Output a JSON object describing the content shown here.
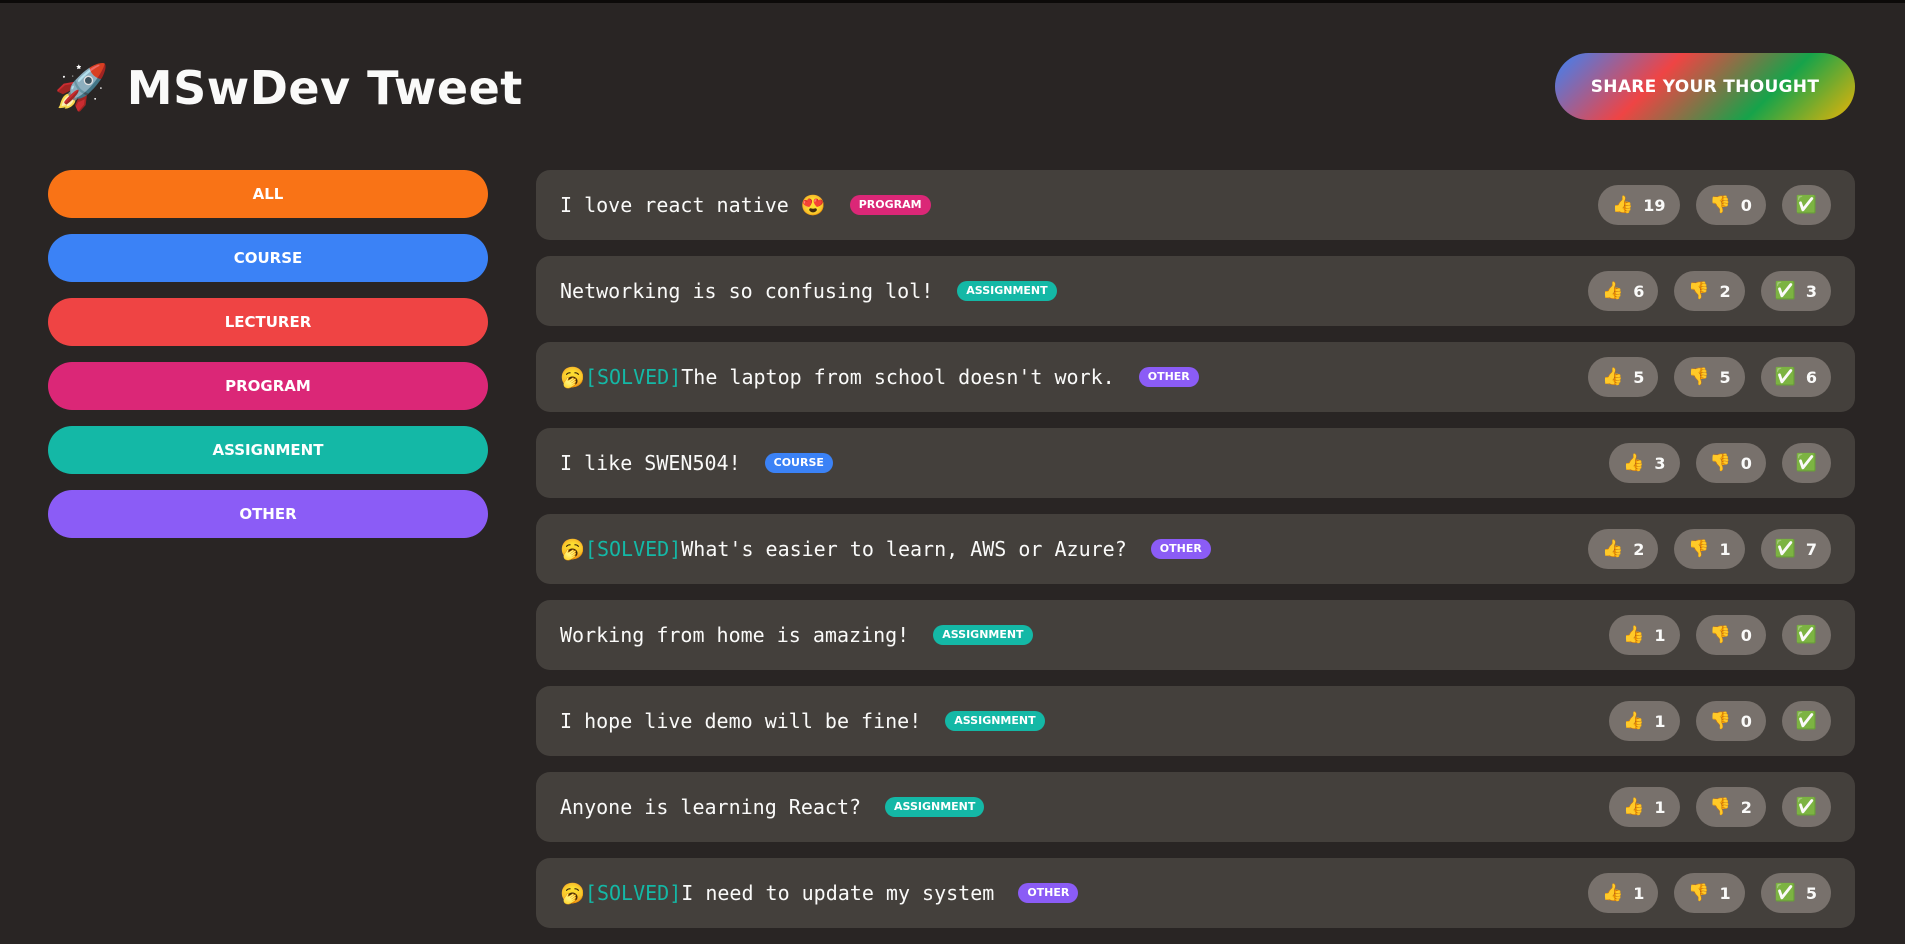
{
  "header": {
    "logo_icon": "🚀",
    "title": "MSwDev Tweet",
    "share_label": "Share your thought"
  },
  "categories": [
    {
      "label": "all",
      "color": "#f97316"
    },
    {
      "label": "course",
      "color": "#3b82f6"
    },
    {
      "label": "lecturer",
      "color": "#ef4444"
    },
    {
      "label": "program",
      "color": "#db2777"
    },
    {
      "label": "assignment",
      "color": "#14b8a6"
    },
    {
      "label": "other",
      "color": "#8b5cf6"
    }
  ],
  "vote_icons": {
    "interesting": "👍",
    "mindblowing": "👎",
    "solved": "✅"
  },
  "tweets": [
    {
      "solved": false,
      "text": "I love react native 😍",
      "tag": "program",
      "tag_color": "#db2777",
      "likes": "19",
      "dislikes": "0",
      "solved_count": ""
    },
    {
      "solved": false,
      "text": "Networking is so confusing lol!",
      "tag": "assignment",
      "tag_color": "#14b8a6",
      "likes": "6",
      "dislikes": "2",
      "solved_count": "3"
    },
    {
      "solved": true,
      "solved_icon": "🥱",
      "solved_label": "[SOLVED]",
      "text": "The laptop from school doesn't work.",
      "tag": "other",
      "tag_color": "#8b5cf6",
      "likes": "5",
      "dislikes": "5",
      "solved_count": "6"
    },
    {
      "solved": false,
      "text": "I like SWEN504!",
      "tag": "course",
      "tag_color": "#3b82f6",
      "likes": "3",
      "dislikes": "0",
      "solved_count": ""
    },
    {
      "solved": true,
      "solved_icon": "🥱",
      "solved_label": "[SOLVED]",
      "text": "What's easier to learn, AWS or Azure?",
      "tag": "other",
      "tag_color": "#8b5cf6",
      "likes": "2",
      "dislikes": "1",
      "solved_count": "7"
    },
    {
      "solved": false,
      "text": "Working from home is amazing!",
      "tag": "assignment",
      "tag_color": "#14b8a6",
      "likes": "1",
      "dislikes": "0",
      "solved_count": ""
    },
    {
      "solved": false,
      "text": "I hope live demo will be fine!",
      "tag": "assignment",
      "tag_color": "#14b8a6",
      "likes": "1",
      "dislikes": "0",
      "solved_count": ""
    },
    {
      "solved": false,
      "text": "Anyone is learning React?",
      "tag": "assignment",
      "tag_color": "#14b8a6",
      "likes": "1",
      "dislikes": "2",
      "solved_count": ""
    },
    {
      "solved": true,
      "solved_icon": "🥱",
      "solved_label": "[SOLVED]",
      "text": "I need to update my system",
      "tag": "other",
      "tag_color": "#8b5cf6",
      "likes": "1",
      "dislikes": "1",
      "solved_count": "5"
    }
  ]
}
